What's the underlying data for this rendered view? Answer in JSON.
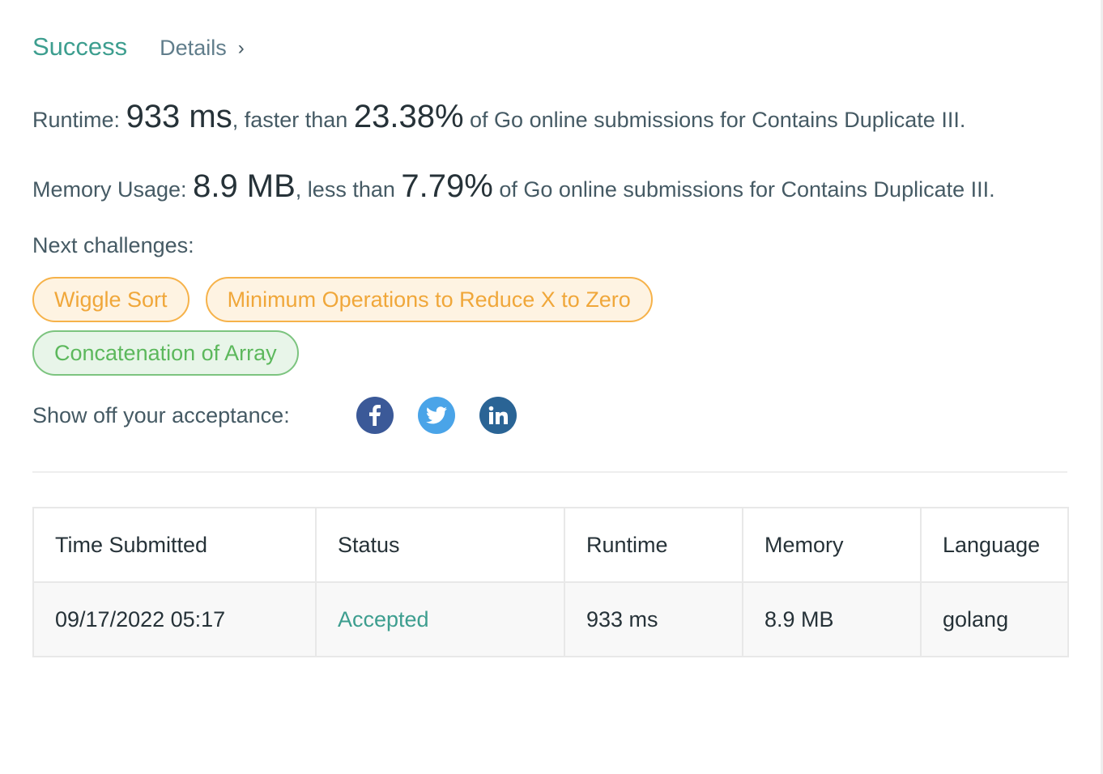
{
  "header": {
    "status": "Success",
    "details_label": "Details",
    "details_chevron": "›"
  },
  "runtime": {
    "label": "Runtime:",
    "value": "933 ms",
    "comma_text": ", faster than",
    "percent": "23.38%",
    "suffix": "of Go online submissions for Contains Duplicate III."
  },
  "memory": {
    "label": "Memory Usage:",
    "value": "8.9 MB",
    "comma_text": ", less than",
    "percent": "7.79%",
    "suffix": "of Go online submissions for Contains Duplicate III."
  },
  "next": {
    "label": "Next challenges:",
    "challenges": [
      {
        "title": "Wiggle Sort",
        "difficulty": "medium"
      },
      {
        "title": "Minimum Operations to Reduce X to Zero",
        "difficulty": "medium"
      },
      {
        "title": "Concatenation of Array",
        "difficulty": "easy"
      }
    ]
  },
  "share": {
    "label": "Show off your acceptance:",
    "icons": [
      "facebook-icon",
      "twitter-icon",
      "linkedin-icon"
    ]
  },
  "colors": {
    "success": "#3d9e8f",
    "medium_chip": "#f0a73a",
    "easy_chip": "#5cb85c",
    "facebook": "#3b5998",
    "twitter": "#4aa4e8",
    "linkedin": "#2a6495"
  },
  "table": {
    "headers": [
      "Time Submitted",
      "Status",
      "Runtime",
      "Memory",
      "Language"
    ],
    "rows": [
      [
        "09/17/2022 05:17",
        "Accepted",
        "933 ms",
        "8.9 MB",
        "golang"
      ]
    ]
  }
}
